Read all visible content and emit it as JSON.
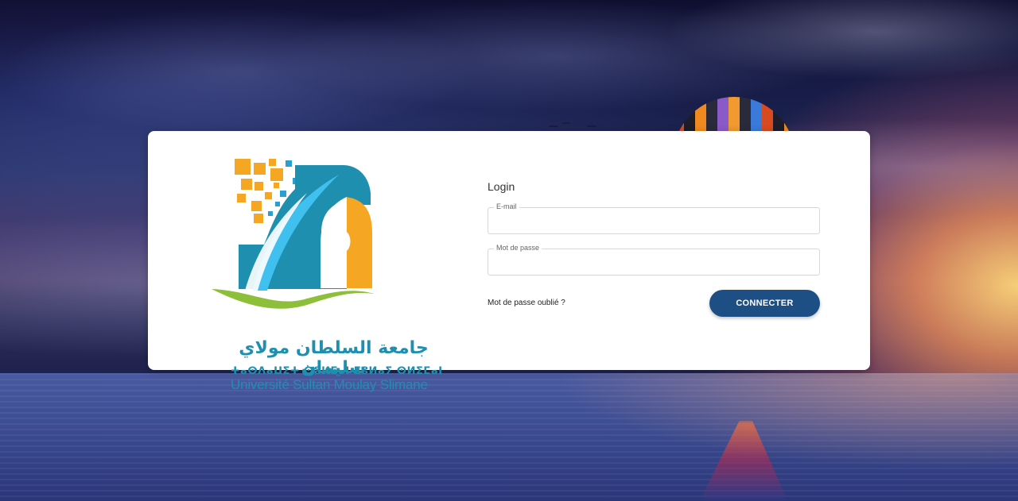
{
  "logo": {
    "arabic_name": "جامعة السلطان مولاي سليمان",
    "tifinagh_name": "ⵜⴰⵙⴷⴰⵡⵉⵜ ⵙⵓⵍⵟⴰⵏ ⵎⵓⵍⴰⵢ ⵙⵍⵉⵎⴰⵏ",
    "latin_name": "Université Sultan Moulay Slimane",
    "colors": {
      "blue": "#1f8fb0",
      "orange": "#f5a623",
      "green": "#8dbf3a"
    }
  },
  "login": {
    "title": "Login",
    "email_label": "E-mail",
    "email_value": "",
    "password_label": "Mot de passe",
    "password_value": "",
    "forgot_password_link": "Mot de passe oublié ?",
    "connect_button": "CONNECTER"
  },
  "theme": {
    "button_color": "#1d4f85"
  }
}
